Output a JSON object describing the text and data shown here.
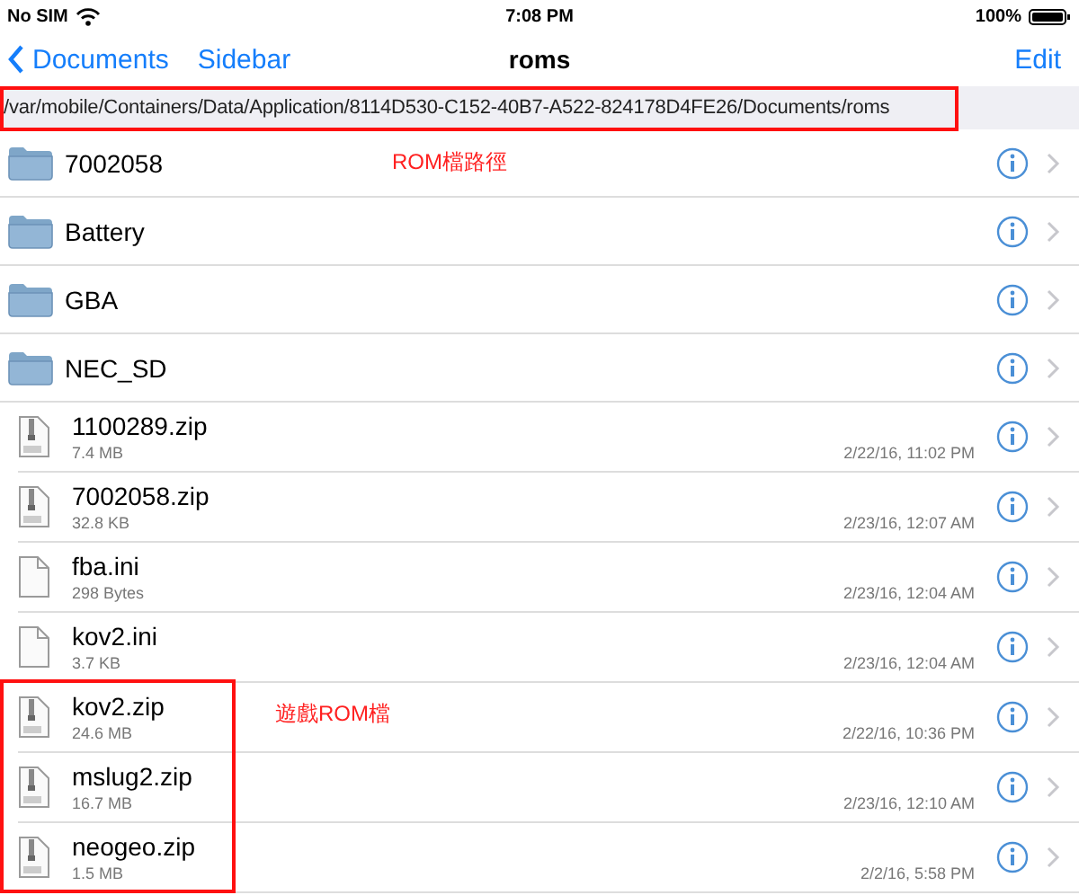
{
  "status_bar": {
    "carrier": "No SIM",
    "time": "7:08 PM",
    "battery": "100%"
  },
  "nav_bar": {
    "back": "Documents",
    "sidebar": "Sidebar",
    "title": "roms",
    "edit": "Edit"
  },
  "path": "/var/mobile/Containers/Data/Application/8114D530-C152-40B7-A522-824178D4FE26/Documents/roms",
  "items": [
    {
      "kind": "folder",
      "name": "7002058"
    },
    {
      "kind": "folder",
      "name": "Battery"
    },
    {
      "kind": "folder",
      "name": "GBA"
    },
    {
      "kind": "folder",
      "name": "NEC_SD"
    },
    {
      "kind": "zip",
      "name": "1100289.zip",
      "size": "7.4 MB",
      "date": "2/22/16, 11:02 PM"
    },
    {
      "kind": "zip",
      "name": "7002058.zip",
      "size": "32.8 KB",
      "date": "2/23/16, 12:07 AM"
    },
    {
      "kind": "file",
      "name": "fba.ini",
      "size": "298 Bytes",
      "date": "2/23/16, 12:04 AM"
    },
    {
      "kind": "file",
      "name": "kov2.ini",
      "size": "3.7 KB",
      "date": "2/23/16, 12:04 AM"
    },
    {
      "kind": "zip",
      "name": "kov2.zip",
      "size": "24.6 MB",
      "date": "2/22/16, 10:36 PM"
    },
    {
      "kind": "zip",
      "name": "mslug2.zip",
      "size": "16.7 MB",
      "date": "2/23/16, 12:10 AM"
    },
    {
      "kind": "zip",
      "name": "neogeo.zip",
      "size": "1.5 MB",
      "date": "2/2/16, 5:58 PM"
    }
  ],
  "annotations": [
    {
      "kind": "path-note",
      "text": "ROM檔路徑"
    },
    {
      "kind": "rom-note",
      "text": "遊戲ROM檔"
    }
  ]
}
